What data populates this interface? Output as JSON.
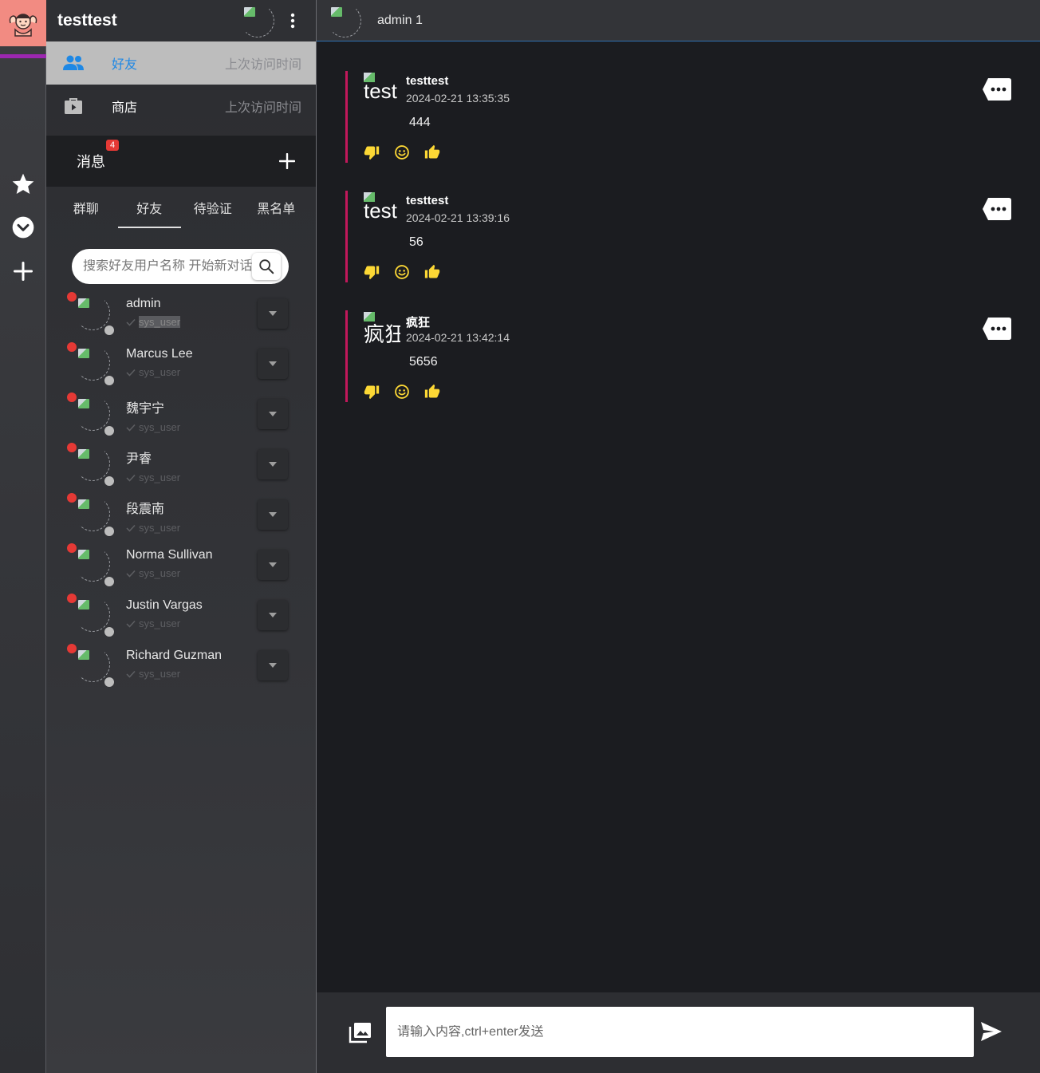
{
  "user": {
    "name": "testtest"
  },
  "nav": [
    {
      "label": "好友",
      "meta": "上次访问时间",
      "active": true
    },
    {
      "label": "商店",
      "meta": "上次访问时间",
      "active": false
    }
  ],
  "messages_section": {
    "title": "消息",
    "badge": "4"
  },
  "tabs": [
    "群聊",
    "好友",
    "待验证",
    "黑名单"
  ],
  "active_tab": "好友",
  "search": {
    "placeholder": "搜索好友用户名称 开始新对话"
  },
  "friends": [
    {
      "name": "admin",
      "role": "sys_user"
    },
    {
      "name": "Marcus Lee",
      "role": "sys_user"
    },
    {
      "name": "魏宇宁",
      "role": "sys_user"
    },
    {
      "name": "尹睿",
      "role": "sys_user"
    },
    {
      "name": "段震南",
      "role": "sys_user"
    },
    {
      "name": "Norma Sullivan",
      "role": "sys_user"
    },
    {
      "name": "Justin Vargas",
      "role": "sys_user"
    },
    {
      "name": "Richard Guzman",
      "role": "sys_user"
    }
  ],
  "chat": {
    "title": "admin 1",
    "messages": [
      {
        "avatar_alt": "test",
        "author": "testtest",
        "time": "2024-02-21 13:35:35",
        "text": "444"
      },
      {
        "avatar_alt": "test",
        "author": "testtest",
        "time": "2024-02-21 13:39:16",
        "text": "56"
      },
      {
        "avatar_alt": "疯狂",
        "author": "疯狂",
        "time": "2024-02-21 13:42:14",
        "text": "5656"
      }
    ],
    "composer_placeholder": "请输入内容,ctrl+enter发送"
  },
  "colors": {
    "accent_blue": "#1e88e5",
    "rail_logo": "#f28b82",
    "rail_bar": "#9c27b0",
    "message_border": "#c2185b",
    "reaction_yellow": "#fdd835",
    "badge_red": "#e53935"
  },
  "icons": {
    "nav": [
      "people-icon",
      "shop-bag-icon"
    ],
    "rail": [
      "avatar-logo-icon",
      "star-icon",
      "chevron-down-circle-icon",
      "plus-icon"
    ],
    "reactions": [
      "thumb-down-icon",
      "smiley-icon",
      "thumb-up-icon"
    ]
  }
}
